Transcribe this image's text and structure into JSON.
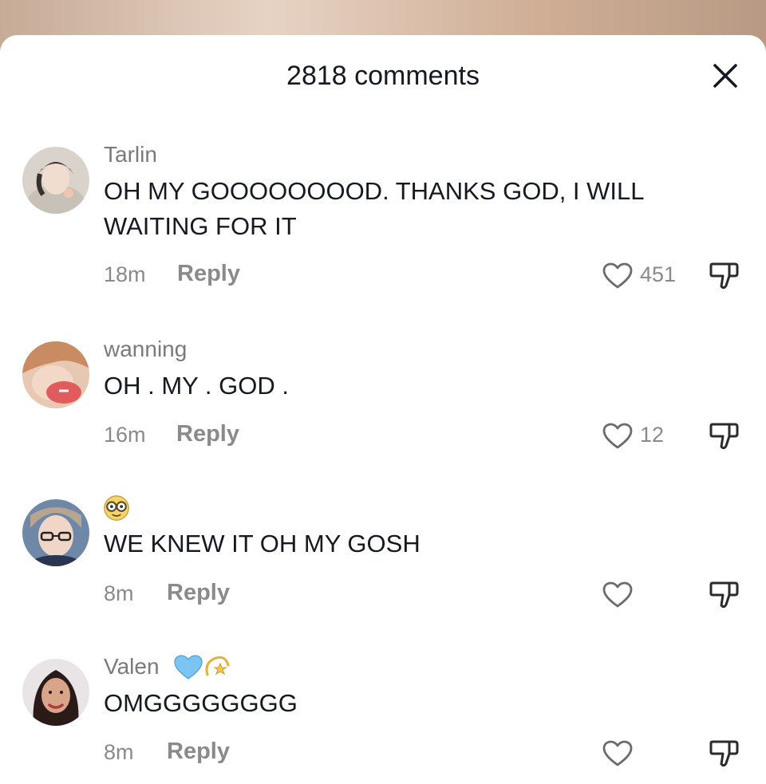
{
  "header": {
    "title": "2818 comments",
    "close_icon": "close-icon"
  },
  "comments": [
    {
      "username": "Tarlin",
      "text": "OH MY GOOOOOOOOD. THANKS GOD, I WILL WAITING FOR IT",
      "time": "18m",
      "reply_label": "Reply",
      "likes": "451"
    },
    {
      "username": "wanning",
      "text": "OH . MY . GOD .",
      "time": "16m",
      "reply_label": "Reply",
      "likes": "12"
    },
    {
      "username": "",
      "username_emoji": "face-with-glasses-emoji",
      "text": "WE KNEW IT OH MY GOSH",
      "time": "8m",
      "reply_label": "Reply",
      "likes": ""
    },
    {
      "username": "Valen",
      "username_emoji": [
        "blue-heart-emoji",
        "dizzy-emoji"
      ],
      "text": "OMGGGGGGGG",
      "time": "8m",
      "reply_label": "Reply",
      "likes": ""
    }
  ],
  "colors": {
    "text": "#161823",
    "muted": "#8a8a8a",
    "sheet": "#ffffff",
    "blue_heart": "#7cc4f2",
    "dizzy": "#f2c94c"
  }
}
